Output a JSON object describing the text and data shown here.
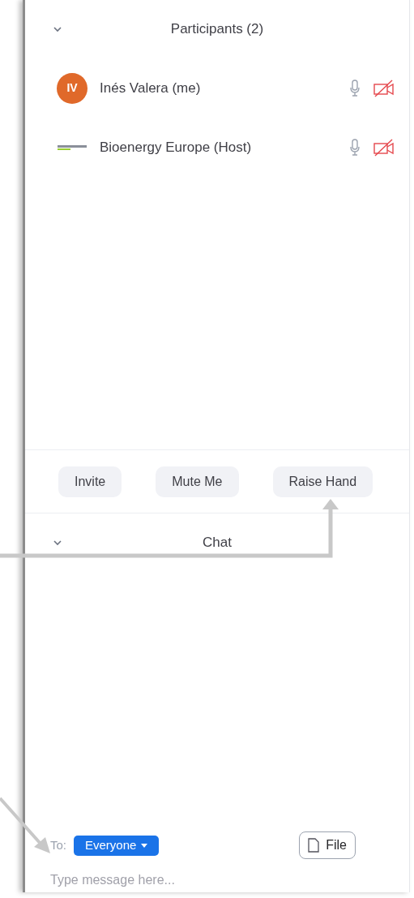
{
  "participants": {
    "title": "Participants (2)",
    "expanded": true,
    "items": [
      {
        "name": "Inés Valera (me)",
        "avatar": {
          "kind": "initials",
          "text": "IV",
          "color": "#e0692a"
        },
        "video_off": true
      },
      {
        "name": "Bioenergy Europe (Host)",
        "avatar": {
          "kind": "logo"
        },
        "video_off": true
      }
    ],
    "buttons": [
      "Invite",
      "Mute Me",
      "Raise Hand"
    ]
  },
  "chat": {
    "title": "Chat",
    "expanded": true,
    "to_label": "To:",
    "recipient": "Everyone",
    "file_button": "File",
    "placeholder": "Type message here..."
  }
}
